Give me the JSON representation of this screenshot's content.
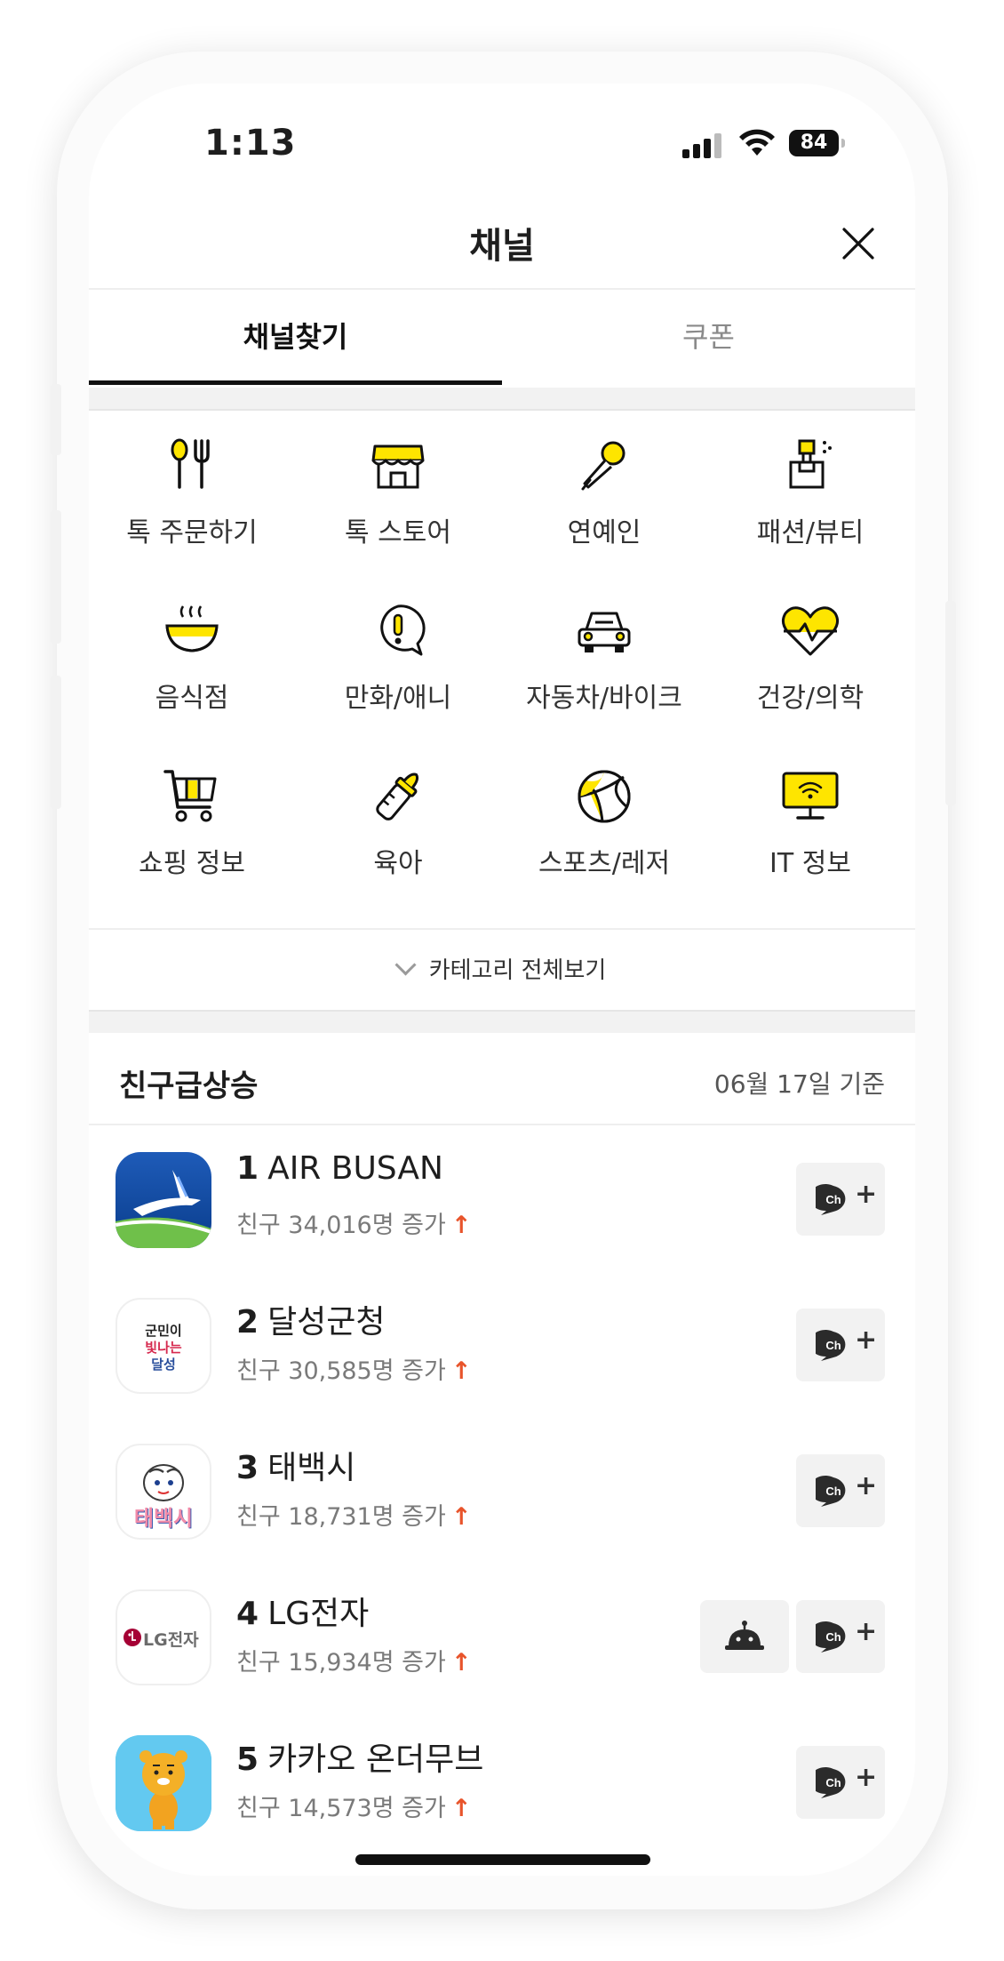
{
  "status": {
    "time": "1:13",
    "battery": "84"
  },
  "header": {
    "title": "채널"
  },
  "tabs": [
    {
      "label": "채널찾기"
    },
    {
      "label": "쿠폰"
    }
  ],
  "categories": [
    {
      "label": "톡 주문하기",
      "icon": "fork-spoon-icon"
    },
    {
      "label": "톡 스토어",
      "icon": "store-icon"
    },
    {
      "label": "연예인",
      "icon": "microphone-icon"
    },
    {
      "label": "패션/뷰티",
      "icon": "perfume-icon"
    },
    {
      "label": "음식점",
      "icon": "bowl-icon"
    },
    {
      "label": "만화/애니",
      "icon": "speech-exclaim-icon"
    },
    {
      "label": "자동차/바이크",
      "icon": "car-icon"
    },
    {
      "label": "건강/의학",
      "icon": "heart-pulse-icon"
    },
    {
      "label": "쇼핑 정보",
      "icon": "cart-icon"
    },
    {
      "label": "육아",
      "icon": "baby-bottle-icon"
    },
    {
      "label": "스포츠/레저",
      "icon": "ball-icon"
    },
    {
      "label": "IT 정보",
      "icon": "monitor-wifi-icon"
    }
  ],
  "more": {
    "label": "카테고리 전체보기"
  },
  "ranking": {
    "title": "친구급상승",
    "date": "06월 17일 기준",
    "items": [
      {
        "rank": "1",
        "name": "AIR BUSAN",
        "sub": "친구 34,016명 증가",
        "logo": "airbusan-logo"
      },
      {
        "rank": "2",
        "name": "달성군청",
        "sub": "친구 30,585명 증가",
        "logo": "dalseong-logo",
        "logo_text": [
          "군민이",
          "빛나는",
          "달성"
        ]
      },
      {
        "rank": "3",
        "name": "태백시",
        "sub": "친구 18,731명 증가",
        "logo": "taebaek-logo",
        "logo_text": "태백시"
      },
      {
        "rank": "4",
        "name": "LG전자",
        "sub": "친구 15,934명 증가",
        "logo": "lg-logo",
        "logo_text": "LG전자"
      },
      {
        "rank": "5",
        "name": "카카오 온더무브",
        "sub": "친구 14,573명 증가",
        "logo": "kakao-onthemove-logo"
      }
    ]
  },
  "arrow": "↑",
  "colors": {
    "accent_yellow": "#fee500",
    "up_arrow": "#e8542b",
    "divider": "#eeeeee"
  }
}
